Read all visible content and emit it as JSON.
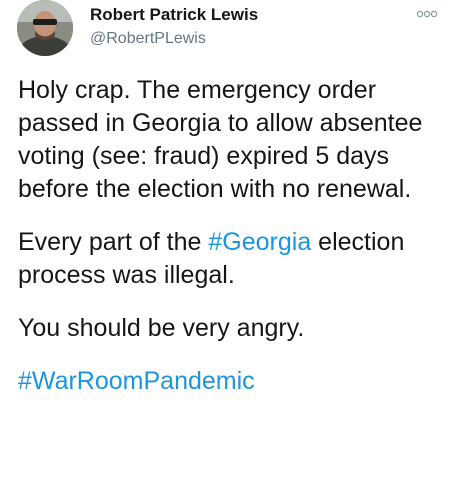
{
  "author": {
    "name": "Robert Patrick Lewis",
    "handle": "@RobertPLewis"
  },
  "tweet": {
    "p1": "Holy crap. The emergency order passed in Georgia to allow absentee voting (see: fraud) expired 5 days before the election with no renewal.",
    "p2_before": "Every part of the ",
    "p2_hashtag": "#Georgia",
    "p2_after": " election process was illegal.",
    "p3": "You should be very angry.",
    "hashtag_final": "#WarRoomPandemic"
  },
  "colors": {
    "hashtag": "#1b95e0",
    "handle": "#657786",
    "text": "#14171a"
  }
}
